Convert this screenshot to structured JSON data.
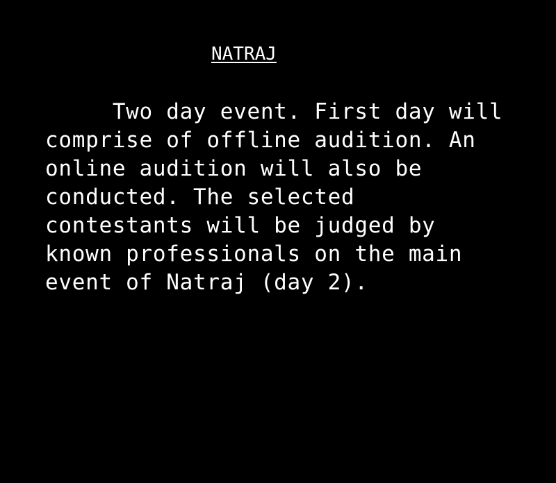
{
  "title": "NATRAJ",
  "description_lines": [
    "     Two day event. First day will",
    "comprise of offline audition. An",
    "online audition will also be",
    "conducted. The selected",
    "contestants will be judged by",
    "known professionals on the main",
    "event of Natraj (day 2)."
  ],
  "colors": {
    "background": "#000000",
    "text": "#ffffff"
  }
}
